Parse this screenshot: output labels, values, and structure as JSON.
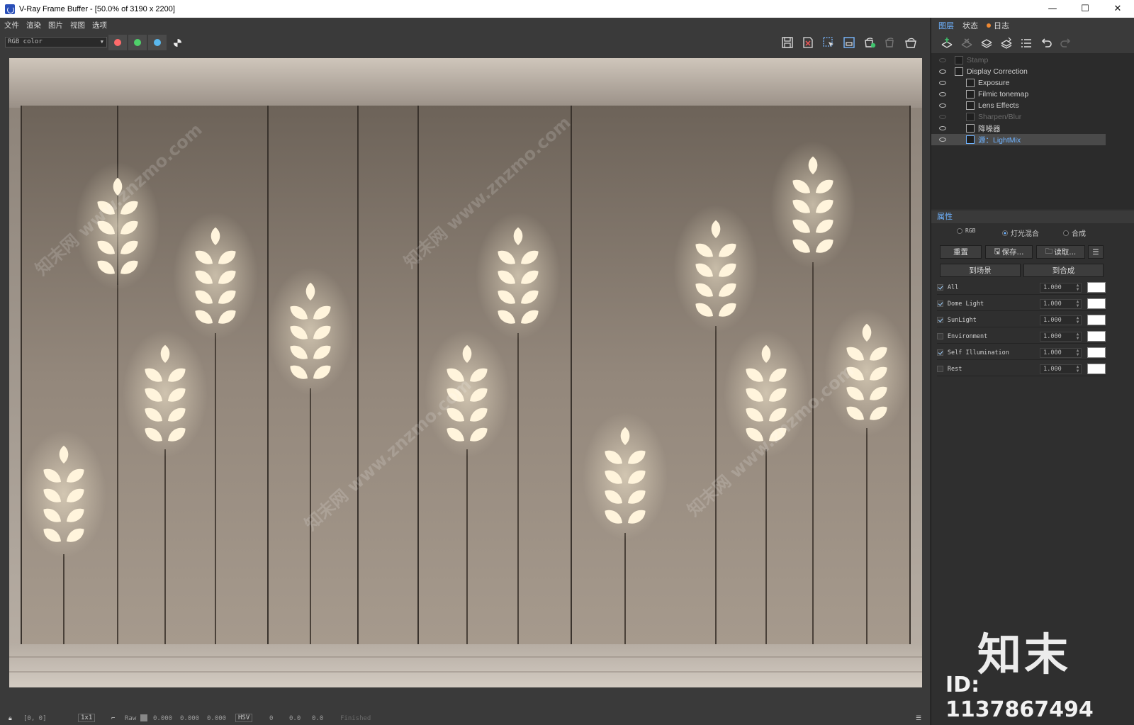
{
  "window": {
    "title": "V-Ray Frame Buffer - [50.0% of 3190 x 2200]",
    "minimize": "—",
    "maximize": "☐",
    "close": "✕"
  },
  "menu": [
    "文件",
    "渲染",
    "图片",
    "视图",
    "选项"
  ],
  "toolbar": {
    "channel": "RGB color",
    "channel_dots": [
      {
        "name": "red-channel",
        "color": "#ff6b6b"
      },
      {
        "name": "green-channel",
        "color": "#4fd06a"
      },
      {
        "name": "blue-channel",
        "color": "#5ab8ee"
      }
    ],
    "icons": [
      "save-image-icon",
      "clear-image-icon",
      "region-render-icon",
      "track-mouse-icon",
      "render-icon",
      "stop-render-icon",
      "render-last-icon"
    ]
  },
  "viewport": {
    "watermark": "知末网 www.znzmo.com"
  },
  "status": {
    "coords": "[0, 0]",
    "zoom": "1x1",
    "raw_label": "Raw",
    "values": [
      "0.000",
      "0.000",
      "0.000"
    ],
    "color_mode": "HSV",
    "hsv_values": [
      "0",
      "0.0",
      "0.0"
    ],
    "render_state": "Finished"
  },
  "right_panel": {
    "tabs": [
      {
        "label": "图层",
        "active": true
      },
      {
        "label": "状态",
        "active": false
      },
      {
        "label": "日志",
        "active": false
      }
    ],
    "layer_tool_icons": [
      "add-layer-icon",
      "delete-layer-icon",
      "save-layer-tree-icon",
      "load-layer-tree-icon",
      "layer-list-icon",
      "undo-icon",
      "redo-icon"
    ],
    "layers": [
      {
        "label": "Stamp",
        "visible": false,
        "indent": 0,
        "icon": "stamp-icon",
        "dim": true
      },
      {
        "label": "Display Correction",
        "visible": true,
        "indent": 0,
        "icon": "display-correction-icon",
        "dim": false
      },
      {
        "label": "Exposure",
        "visible": true,
        "indent": 1,
        "icon": "exposure-icon",
        "dim": false
      },
      {
        "label": "Filmic tonemap",
        "visible": true,
        "indent": 1,
        "icon": "filmic-tonemap-icon",
        "dim": false
      },
      {
        "label": "Lens Effects",
        "visible": true,
        "indent": 1,
        "icon": "lens-effects-icon",
        "dim": false
      },
      {
        "label": "Sharpen/Blur",
        "visible": false,
        "indent": 1,
        "icon": "sharpen-blur-icon",
        "dim": true
      },
      {
        "label": "降噪器",
        "visible": true,
        "indent": 1,
        "icon": "denoiser-icon",
        "dim": false
      },
      {
        "label": "源：LightMix",
        "visible": true,
        "indent": 1,
        "icon": "lightmix-icon",
        "dim": false,
        "selected": true
      }
    ],
    "properties_label": "属性",
    "source_modes": [
      {
        "label": "RGB",
        "selected": false
      },
      {
        "label": "灯光混合",
        "selected": true
      },
      {
        "label": "合成",
        "selected": false
      }
    ],
    "buttons": {
      "reset": "重置",
      "save": "保存...",
      "load": "读取...",
      "to_scene": "到场景",
      "to_composite": "到合成"
    },
    "lightmix": [
      {
        "name": "All",
        "checked": true,
        "value": "1.000",
        "color": "#ffffff"
      },
      {
        "name": "Dome Light",
        "checked": true,
        "value": "1.000",
        "color": "#ffffff"
      },
      {
        "name": "SunLight",
        "checked": true,
        "value": "1.000",
        "color": "#ffffff"
      },
      {
        "name": "Environment",
        "checked": false,
        "value": "1.000",
        "color": "#ffffff"
      },
      {
        "name": "Self Illumination",
        "checked": true,
        "value": "1.000",
        "color": "#ffffff"
      },
      {
        "name": "Rest",
        "checked": false,
        "value": "1.000",
        "color": "#ffffff"
      }
    ]
  },
  "brand_watermark": {
    "logo_text": "知末",
    "id_text": "ID: 1137867494"
  }
}
